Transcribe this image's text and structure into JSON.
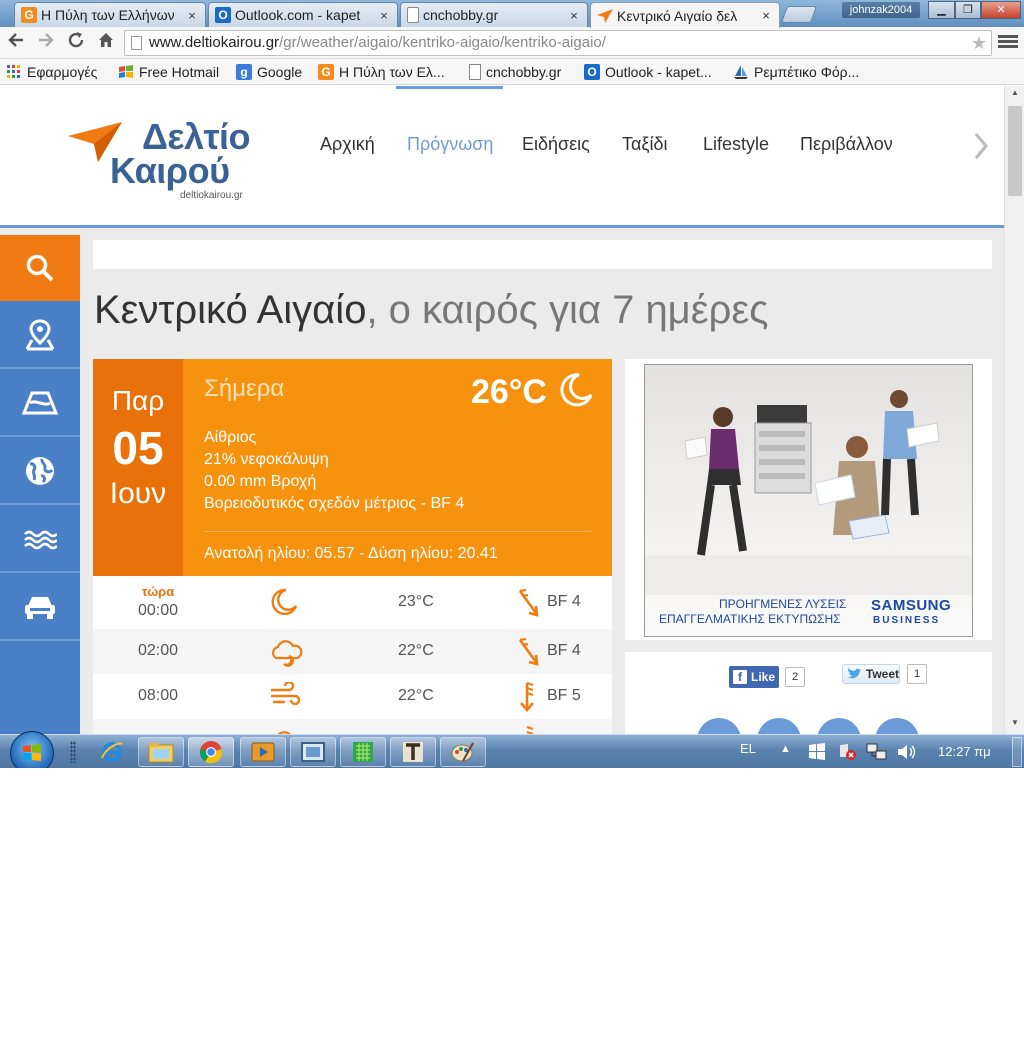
{
  "browser": {
    "tabs": [
      {
        "title": "Η Πύλη των Ελλήνων",
        "favicon": "g-icon",
        "fav_color": "#f28c1e"
      },
      {
        "title": "Outlook.com - kapet",
        "favicon": "outlook-icon",
        "fav_color": "#1a6bc7"
      },
      {
        "title": "cnchobby.gr",
        "favicon": "page-icon",
        "fav_color": "#ffffff"
      },
      {
        "title": "Κεντρικό Αιγαίο δελ",
        "favicon": "paper-plane-icon",
        "fav_color": "#f07b12"
      }
    ],
    "close_glyph": "×",
    "profile_name": "johnzak2004",
    "address": {
      "domain": "www.deltiokairou.gr",
      "path": "/gr/weather/aigaio/kentriko-aigaio/kentriko-aigaio/"
    },
    "bookmarks": [
      {
        "label": "Εφαρμογές",
        "icon": "apps-grid-icon"
      },
      {
        "label": "Free Hotmail",
        "icon": "windows-flag-icon"
      },
      {
        "label": "Google",
        "icon": "google-g-icon"
      },
      {
        "label": "Η Πύλη των Ελ...",
        "icon": "g-icon"
      },
      {
        "label": "cnchobby.gr",
        "icon": "page-icon"
      },
      {
        "label": "Outlook - kapet...",
        "icon": "outlook-icon"
      },
      {
        "label": "Ρεμπέτικο Φόρ...",
        "icon": "sailboat-icon"
      }
    ]
  },
  "site": {
    "logo": {
      "line1": "Δελτίο",
      "line2": "Καιρού",
      "domain": "deltiokairou.gr"
    },
    "nav": [
      "Αρχική",
      "Πρόγνωση",
      "Ειδήσεις",
      "Ταξίδι",
      "Lifestyle",
      "Περιβάλλον"
    ],
    "nav_active_index": 1,
    "sidebar_icons": [
      "search-icon",
      "map-pin-icon",
      "road-icon",
      "globe-icon",
      "sea-waves-icon",
      "car-icon"
    ],
    "title_main": "Κεντρικό Αιγαίο",
    "title_rest": ", ο καιρός για 7 ημέρες",
    "today": {
      "dow": "Παρ",
      "day": "05",
      "month": "Ιουν",
      "label": "Σήμερα",
      "temp": "26°C",
      "conditions": [
        "Αίθριος",
        "21% νεφοκάλυψη",
        "0.00 mm Βροχή",
        "Βορειοδυτικός σχεδόν μέτριος - BF 4"
      ],
      "sun": "Ανατολή ηλίου: 05.57 - Δύση ηλίου: 20.41"
    },
    "hourly": [
      {
        "now": "τώρα",
        "time": "00:00",
        "icon": "moon-icon",
        "temp": "23°C",
        "wind": "BF 4"
      },
      {
        "now": "",
        "time": "02:00",
        "icon": "cloud-moon-icon",
        "temp": "22°C",
        "wind": "BF 4"
      },
      {
        "now": "",
        "time": "08:00",
        "icon": "wind-icon",
        "temp": "22°C",
        "wind": "BF 5"
      }
    ],
    "ad": {
      "caption_line1": "ΠΡΟΗΓΜΕΝΕΣ ΛΥΣΕΙΣ",
      "caption_line2": "ΕΠΑΓΓΕΛΜΑΤΙΚΗΣ ΕΚΤΥΠΩΣΗΣ",
      "brand": "SAMSUNG",
      "brand_sub": "BUSINESS"
    },
    "social": {
      "like_label": "Like",
      "like_count": "2",
      "tweet_label": "Tweet",
      "tweet_count": "1"
    }
  },
  "taskbar": {
    "language": "EL",
    "clock": "12:27 πμ",
    "apps": [
      "internet-explorer-icon",
      "file-explorer-icon",
      "chrome-icon",
      "media-player-icon",
      "window-app-icon",
      "green-app-icon",
      "font-app-icon",
      "paint-icon"
    ]
  },
  "colors": {
    "accent_orange": "#f7920e",
    "date_orange": "#e8710a",
    "brand_blue": "#3a6294",
    "nav_blue": "#6b9bd6",
    "sidebar_blue": "#4a80c7"
  }
}
